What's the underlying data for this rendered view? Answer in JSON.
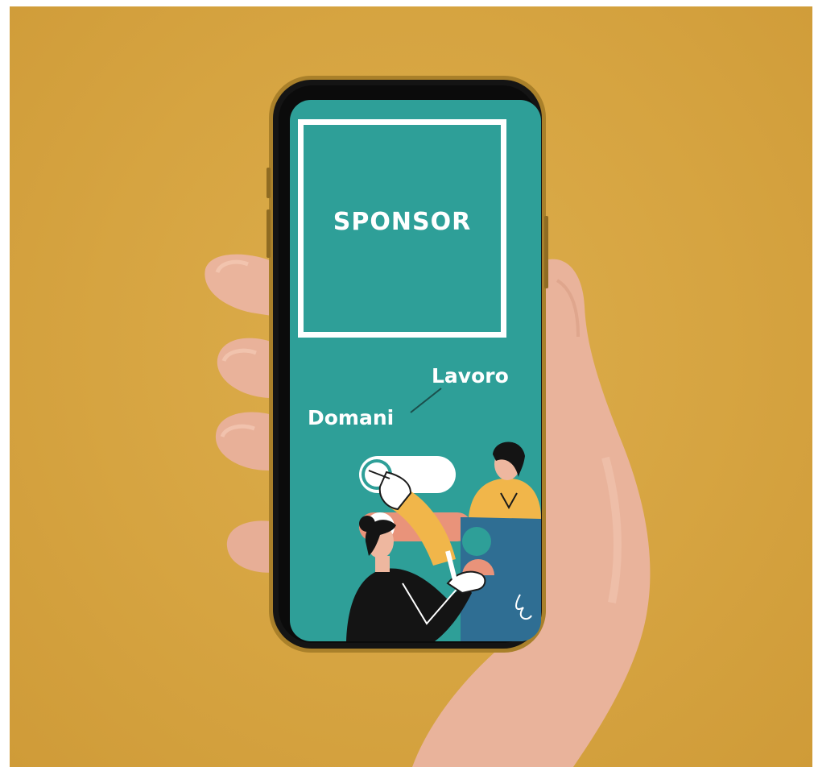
{
  "screen": {
    "sponsor_label": "SPONSOR",
    "word_top": "Lavoro",
    "word_bottom": "Domani"
  },
  "colors": {
    "background": "#d6a441",
    "screen_teal": "#2e9f98",
    "white": "#ffffff",
    "skin": "#eeb79f",
    "phone_frame": "#1d1d1d",
    "phone_gold": "#b58a2c",
    "illustration_yellow": "#f1b64a",
    "illustration_blue": "#2f6e93",
    "illustration_salmon": "#e9937a"
  },
  "illustration": {
    "subjects": [
      "toggle-switch",
      "pointing-man",
      "gesturing-woman"
    ]
  }
}
